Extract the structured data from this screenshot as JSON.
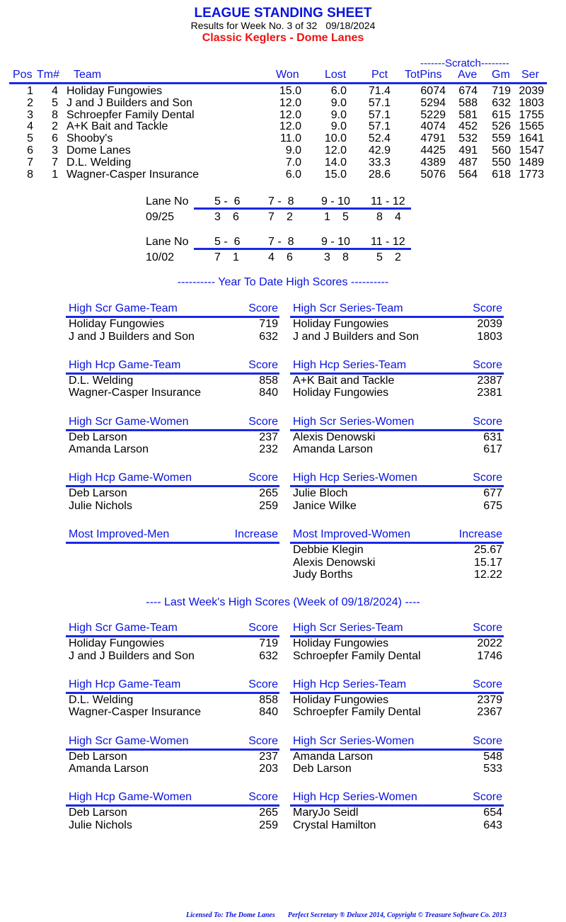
{
  "header": {
    "title": "LEAGUE STANDING SHEET",
    "results_for": "Results for Week No. 3 of 32",
    "date": "09/18/2024",
    "league": "Classic Keglers - Dome Lanes"
  },
  "colors": {
    "accent_blue": "#0a14dc",
    "league_red": "#ee1111",
    "text": "#000000"
  },
  "standings": {
    "scratch_group_label": "-------Scratch--------",
    "columns": [
      "Pos",
      "Tm#",
      "Team",
      "Won",
      "Lost",
      "Pct",
      "TotPins",
      "Ave",
      "Gm",
      "Ser"
    ],
    "rows": [
      {
        "pos": "1",
        "tm": "4",
        "team": "Holiday Fungowies",
        "won": "15.0",
        "lost": "6.0",
        "pct": "71.4",
        "totpins": "6074",
        "ave": "674",
        "gm": "719",
        "ser": "2039"
      },
      {
        "pos": "2",
        "tm": "5",
        "team": "J and J Builders and Son",
        "won": "12.0",
        "lost": "9.0",
        "pct": "57.1",
        "totpins": "5294",
        "ave": "588",
        "gm": "632",
        "ser": "1803"
      },
      {
        "pos": "3",
        "tm": "8",
        "team": "Schroepfer Family Dental",
        "won": "12.0",
        "lost": "9.0",
        "pct": "57.1",
        "totpins": "5229",
        "ave": "581",
        "gm": "615",
        "ser": "1755"
      },
      {
        "pos": "4",
        "tm": "2",
        "team": "A+K Bait and Tackle",
        "won": "12.0",
        "lost": "9.0",
        "pct": "57.1",
        "totpins": "4074",
        "ave": "452",
        "gm": "526",
        "ser": "1565"
      },
      {
        "pos": "5",
        "tm": "6",
        "team": "Shooby's",
        "won": "11.0",
        "lost": "10.0",
        "pct": "52.4",
        "totpins": "4791",
        "ave": "532",
        "gm": "559",
        "ser": "1641"
      },
      {
        "pos": "6",
        "tm": "3",
        "team": "Dome Lanes",
        "won": "9.0",
        "lost": "12.0",
        "pct": "42.9",
        "totpins": "4425",
        "ave": "491",
        "gm": "560",
        "ser": "1547"
      },
      {
        "pos": "7",
        "tm": "7",
        "team": "D.L. Welding",
        "won": "7.0",
        "lost": "14.0",
        "pct": "33.3",
        "totpins": "4389",
        "ave": "487",
        "gm": "550",
        "ser": "1489"
      },
      {
        "pos": "8",
        "tm": "1",
        "team": "Wagner-Casper Insurance",
        "won": "6.0",
        "lost": "15.0",
        "pct": "28.6",
        "totpins": "5076",
        "ave": "564",
        "gm": "618",
        "ser": "1773"
      }
    ]
  },
  "lane_assignments": [
    {
      "label": "Lane No",
      "lanes": [
        "5 -  6",
        "7 -  8",
        "9 - 10",
        "11 - 12"
      ],
      "date": "09/25",
      "pairs": [
        [
          "3",
          "6"
        ],
        [
          "7",
          "2"
        ],
        [
          "1",
          "5"
        ],
        [
          "8",
          "4"
        ]
      ]
    },
    {
      "label": "Lane No",
      "lanes": [
        "5 -  6",
        "7 -  8",
        "9 - 10",
        "11 - 12"
      ],
      "date": "10/02",
      "pairs": [
        [
          "7",
          "1"
        ],
        [
          "4",
          "6"
        ],
        [
          "3",
          "8"
        ],
        [
          "5",
          "2"
        ]
      ]
    }
  ],
  "ytd": {
    "heading": "---------- Year To Date High Scores ----------",
    "boxes": [
      {
        "title": "High Scr Game-Team",
        "col": "Score",
        "items": [
          {
            "name": "Holiday Fungowies",
            "value": "719"
          },
          {
            "name": "J and J Builders and Son",
            "value": "632"
          }
        ]
      },
      {
        "title": "High Scr Series-Team",
        "col": "Score",
        "items": [
          {
            "name": "Holiday Fungowies",
            "value": "2039"
          },
          {
            "name": "J and J Builders and Son",
            "value": "1803"
          }
        ]
      },
      {
        "title": "High Hcp Game-Team",
        "col": "Score",
        "items": [
          {
            "name": "D.L. Welding",
            "value": "858"
          },
          {
            "name": "Wagner-Casper Insurance",
            "value": "840"
          }
        ]
      },
      {
        "title": "High Hcp Series-Team",
        "col": "Score",
        "items": [
          {
            "name": "A+K Bait and Tackle",
            "value": "2387"
          },
          {
            "name": "Holiday Fungowies",
            "value": "2381"
          }
        ]
      },
      {
        "title": "High Scr Game-Women",
        "col": "Score",
        "items": [
          {
            "name": "Deb Larson",
            "value": "237"
          },
          {
            "name": "Amanda Larson",
            "value": "232"
          }
        ]
      },
      {
        "title": "High Scr Series-Women",
        "col": "Score",
        "items": [
          {
            "name": "Alexis Denowski",
            "value": "631"
          },
          {
            "name": "Amanda Larson",
            "value": "617"
          }
        ]
      },
      {
        "title": "High Hcp Game-Women",
        "col": "Score",
        "items": [
          {
            "name": "Deb Larson",
            "value": "265"
          },
          {
            "name": "Julie Nichols",
            "value": "259"
          }
        ]
      },
      {
        "title": "High Hcp Series-Women",
        "col": "Score",
        "items": [
          {
            "name": "Julie Bloch",
            "value": "677"
          },
          {
            "name": "Janice Wilke",
            "value": "675"
          }
        ]
      },
      {
        "title": "Most Improved-Men",
        "col": "Increase",
        "items": []
      },
      {
        "title": "Most Improved-Women",
        "col": "Increase",
        "items": [
          {
            "name": "Debbie Klegin",
            "value": "25.67"
          },
          {
            "name": "Alexis Denowski",
            "value": "15.17"
          },
          {
            "name": "Judy Borths",
            "value": "12.22"
          }
        ]
      }
    ]
  },
  "last_week": {
    "heading": "----  Last Week's High Scores   (Week of 09/18/2024)  ----",
    "boxes": [
      {
        "title": "High Scr Game-Team",
        "col": "Score",
        "items": [
          {
            "name": "Holiday Fungowies",
            "value": "719"
          },
          {
            "name": "J and J Builders and Son",
            "value": "632"
          }
        ]
      },
      {
        "title": "High Scr Series-Team",
        "col": "Score",
        "items": [
          {
            "name": "Holiday Fungowies",
            "value": "2022"
          },
          {
            "name": "Schroepfer Family Dental",
            "value": "1746"
          }
        ]
      },
      {
        "title": "High Hcp Game-Team",
        "col": "Score",
        "items": [
          {
            "name": "D.L. Welding",
            "value": "858"
          },
          {
            "name": "Wagner-Casper Insurance",
            "value": "840"
          }
        ]
      },
      {
        "title": "High Hcp Series-Team",
        "col": "Score",
        "items": [
          {
            "name": "Holiday Fungowies",
            "value": "2379"
          },
          {
            "name": "Schroepfer Family Dental",
            "value": "2367"
          }
        ]
      },
      {
        "title": "High Scr Game-Women",
        "col": "Score",
        "items": [
          {
            "name": "Deb Larson",
            "value": "237"
          },
          {
            "name": "Amanda Larson",
            "value": "203"
          }
        ]
      },
      {
        "title": "High Scr Series-Women",
        "col": "Score",
        "items": [
          {
            "name": "Amanda Larson",
            "value": "548"
          },
          {
            "name": "Deb Larson",
            "value": "533"
          }
        ]
      },
      {
        "title": "High Hcp Game-Women",
        "col": "Score",
        "items": [
          {
            "name": "Deb Larson",
            "value": "265"
          },
          {
            "name": "Julie Nichols",
            "value": "259"
          }
        ]
      },
      {
        "title": "High Hcp Series-Women",
        "col": "Score",
        "items": [
          {
            "name": "MaryJo Seidl",
            "value": "654"
          },
          {
            "name": "Crystal Hamilton",
            "value": "643"
          }
        ]
      }
    ]
  },
  "footer": {
    "licensed": "Licensed To: The Dome Lanes",
    "software": "Perfect Secretary ® Deluxe  2014, Copyright © Treasure Software Co. 2013"
  }
}
